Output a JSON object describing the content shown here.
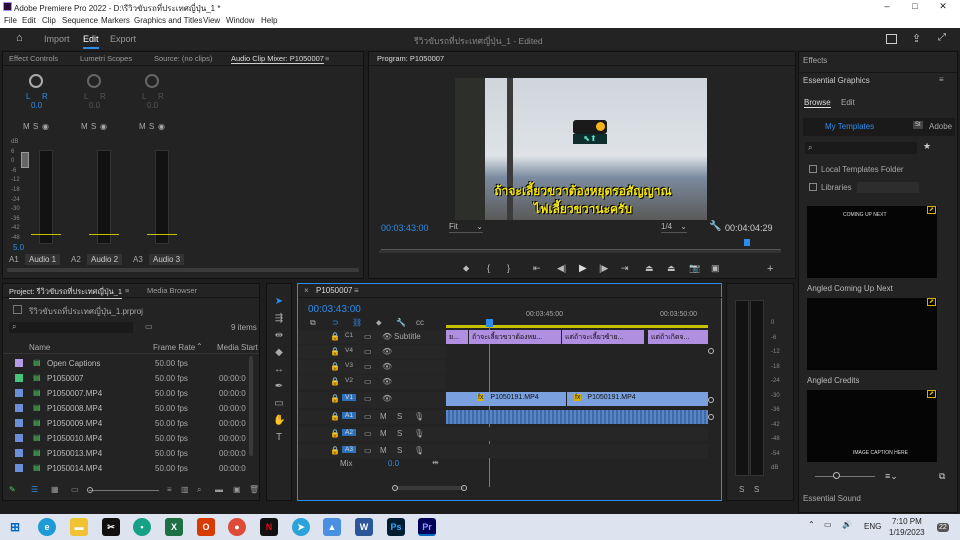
{
  "window": {
    "title": "Adobe Premiere Pro 2022 - D:\\รีวิวขับรถที่ประเทศญี่ปุ่น_1 *",
    "controls": {
      "minimize": "–",
      "maximize": "□",
      "close": "✕"
    }
  },
  "menu": [
    "File",
    "Edit",
    "Clip",
    "Sequence",
    "Markers",
    "Graphics and Titles",
    "View",
    "Window",
    "Help"
  ],
  "header": {
    "tabs": [
      "Import",
      "Edit",
      "Export"
    ],
    "active_tab": "Edit",
    "project_title": "รีวิวขับรถที่ประเทศญี่ปุ่น_1",
    "edited_label": "- Edited"
  },
  "source_panel": {
    "tabs": [
      "Effect Controls",
      "Lumetri Scopes",
      "Source: (no clips)",
      "Audio Clip Mixer: P1050007"
    ],
    "channels": [
      {
        "pan_l": "L",
        "pan_r": "R",
        "value": "0.0",
        "name": "Audio 1",
        "id": "A1"
      },
      {
        "pan_l": "L",
        "pan_r": "R",
        "value": "0.0",
        "name": "Audio 2",
        "id": "A2"
      },
      {
        "pan_l": "L",
        "pan_r": "R",
        "value": "0.0",
        "name": "Audio 3",
        "id": "A3"
      }
    ],
    "msr": [
      "M",
      "S",
      "◉"
    ],
    "db_scale": [
      "dB",
      "6",
      "0",
      "-6",
      "-12",
      "-18",
      "-24",
      "-30",
      "-36",
      "-42",
      "-48",
      "-∞"
    ],
    "master_value": "5.0"
  },
  "program_monitor": {
    "title": "Program: P1050007",
    "subtitle_line1": "ถ้าจะเลี้ยวขวาต้องหยุดรอสัญญาณ",
    "subtitle_line2": "ไฟเลี้ยวขวานะครับ",
    "current_time": "00:03:43:00",
    "fit": "Fit",
    "resolution": "1/4",
    "duration": "00:04:04:29",
    "playhead_fraction": 0.914,
    "controls": [
      "marker",
      "in",
      "out",
      "go-in",
      "step-back",
      "play",
      "step-forward",
      "go-out",
      "lift",
      "extract",
      "export-frame",
      "compare",
      "add"
    ]
  },
  "essential_graphics": {
    "effects_tab": "Effects",
    "title": "Essential Graphics",
    "tabs": [
      "Browse",
      "Edit"
    ],
    "my_templates": "My Templates",
    "adobe_stock": "Adobe",
    "local_folder": "Local Templates Folder",
    "libraries": "Libraries",
    "templates": [
      {
        "name": "Angled Coming Up Next",
        "preview_text": "COMING UP NEXT"
      },
      {
        "name": "Angled Credits",
        "preview_text": ""
      },
      {
        "name": "",
        "preview_text": "IMAGE CAPTION HERE"
      }
    ],
    "essential_sound": "Essential Sound"
  },
  "project_panel": {
    "tabs": [
      "Project: รีวิวขับรถที่ประเทศญี่ปุ่น_1",
      "Media Browser"
    ],
    "project_file": "รีวิวขับรถที่ประเทศญี่ปุ่น_1.prproj",
    "items_count": "9 items",
    "columns": [
      "Name",
      "Frame Rate",
      "Media Start"
    ],
    "items": [
      {
        "name": "Open Captions",
        "fps": "50.00 fps",
        "start": "",
        "color": "#b59ae6"
      },
      {
        "name": "P1050007",
        "fps": "50.00 fps",
        "start": "00:00:0",
        "color": "#49c27a"
      },
      {
        "name": "P1050007.MP4",
        "fps": "50.00 fps",
        "start": "00:00:0",
        "color": "#6a8fd8"
      },
      {
        "name": "P1050008.MP4",
        "fps": "50.00 fps",
        "start": "00:00:0",
        "color": "#6a8fd8"
      },
      {
        "name": "P1050009.MP4",
        "fps": "50.00 fps",
        "start": "00:00:0",
        "color": "#6a8fd8"
      },
      {
        "name": "P1050010.MP4",
        "fps": "50.00 fps",
        "start": "00:00:0",
        "color": "#6a8fd8"
      },
      {
        "name": "P1050013.MP4",
        "fps": "50.00 fps",
        "start": "00:00:0",
        "color": "#6a8fd8"
      },
      {
        "name": "P1050014.MP4",
        "fps": "50.00 fps",
        "start": "00:00:0",
        "color": "#6a8fd8"
      }
    ]
  },
  "timeline": {
    "sequence": "P1050007",
    "current_time": "00:03:43:00",
    "ruler": [
      "00:03:45:00",
      "00:03:50:00"
    ],
    "tracks": [
      {
        "id": "C1",
        "label": "Subtitle"
      },
      {
        "id": "V4",
        "label": ""
      },
      {
        "id": "V3",
        "label": ""
      },
      {
        "id": "V2",
        "label": ""
      },
      {
        "id": "V1",
        "label": ""
      },
      {
        "id": "A1",
        "label": ""
      },
      {
        "id": "A2",
        "label": ""
      },
      {
        "id": "A3",
        "label": ""
      }
    ],
    "mix_label": "Mix",
    "mix_value": "0.0",
    "caption_clips": [
      "ย...",
      "ถ้าจะเลี้ยวขวาต้องหย...",
      "แต่ถ้าจะเลี้ยวซ้าย...",
      "แต่ถ้าเกิดจ..."
    ],
    "video_clips": [
      "P1050191.MP4",
      "P1050191.MP4"
    ]
  },
  "master_meter": {
    "scale": [
      "0",
      "-6",
      "-12",
      "-18",
      "-24",
      "-30",
      "-36",
      "-42",
      "-48",
      "-54",
      "dB"
    ],
    "solo": [
      "S",
      "S"
    ]
  },
  "taskbar": {
    "lang": "ENG",
    "time": "7:10 PM",
    "date": "1/19/2023",
    "notifications": "22"
  },
  "colors": {
    "accent": "#2d8ceb",
    "caption_clip": "#b08ee0",
    "video_clip": "#7aa0de",
    "audio_clip": "#5a86c8"
  }
}
